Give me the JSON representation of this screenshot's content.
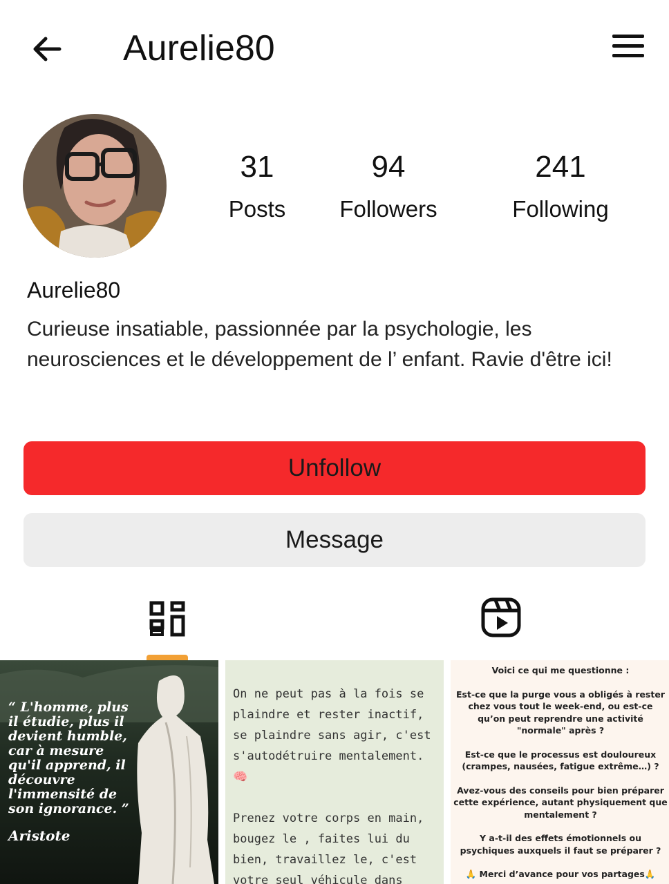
{
  "header": {
    "title": "Aurelie80",
    "back_icon": "arrow-left-icon",
    "menu_icon": "hamburger-menu-icon"
  },
  "profile": {
    "username": "Aurelie80",
    "bio": "Curieuse insatiable, passionnée par la psychologie, les neurosciences et le développement de l’ enfant. Ravie d'être ici!",
    "stats": {
      "posts": {
        "value": "31",
        "label": "Posts"
      },
      "followers": {
        "value": "94",
        "label": "Followers"
      },
      "following": {
        "value": "241",
        "label": "Following"
      }
    }
  },
  "actions": {
    "unfollow_label": "Unfollow",
    "message_label": "Message",
    "unfollow_color": "#f5292b",
    "message_color": "#ededed"
  },
  "tabs": {
    "grid_icon": "grid-icon",
    "reels_icon": "reels-icon",
    "active": "grid",
    "indicator_color": "#f2a035"
  },
  "posts": [
    {
      "quote": "“ L'homme, plus il étudie, plus il devient humble, car à mesure qu'il apprend, il découvre l'immensité de son ignorance. ”",
      "author": "Aristote"
    },
    {
      "para1": "On ne peut pas à la fois se plaindre et rester inactif, se plaindre sans agir, c'est s'autodétruire mentalement. 🧠",
      "para2": "Prenez votre corps en main, bougez le , faites lui du bien, travaillez le, c'est votre seul véhicule dans"
    },
    {
      "lines": [
        "Voici ce qui me questionne :",
        "Est-ce que la purge vous a obligés à rester chez vous tout le week-end, ou est-ce qu’on peut reprendre une activité \"normale\" après ?",
        "Est-ce que le processus est douloureux (crampes, nausées, fatigue extrême…) ?",
        "Avez-vous des conseils pour bien préparer cette expérience, autant physiquement que mentalement ?",
        "Y a-t-il des effets émotionnels ou psychiques auxquels il faut se préparer ?",
        "🙏 Merci d’avance pour vos partages🙏"
      ]
    }
  ]
}
